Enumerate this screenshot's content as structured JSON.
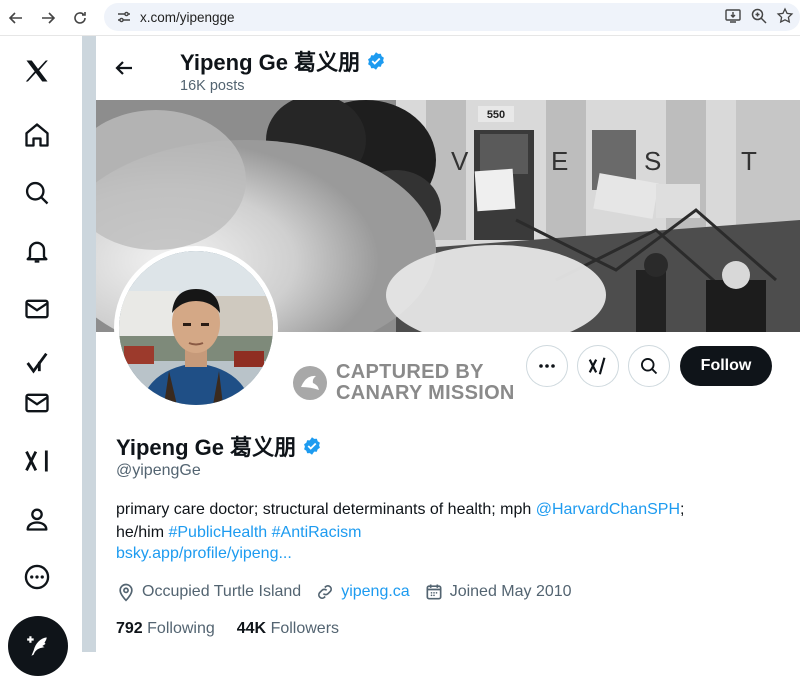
{
  "browser": {
    "url": "x.com/yipengge"
  },
  "header": {
    "name": "Yipeng Ge 葛义朋",
    "posts": "16K posts"
  },
  "banner": {
    "sign_number": "550",
    "graffiti": [
      "V",
      "E",
      "S",
      "T"
    ]
  },
  "watermark": {
    "line1": "CAPTURED BY",
    "line2": "CANARY MISSION"
  },
  "actions": {
    "follow_label": "Follow"
  },
  "profile": {
    "name": "Yipeng Ge 葛义朋",
    "handle": "@yipengGe",
    "bio_text_1": "primary care doctor; structural determinants of health; mph ",
    "bio_mention": "@HarvardChanSPH",
    "bio_text_2": ";",
    "bio_text_3": "he/him ",
    "bio_tag_1": "#PublicHealth",
    "bio_tag_2": "#AntiRacism",
    "bio_link": "bsky.app/profile/yipeng...",
    "location": "Occupied Turtle Island",
    "website": "yipeng.ca",
    "joined": "Joined May 2010",
    "following_count": "792",
    "following_label": "Following",
    "followers_count": "44K",
    "followers_label": "Followers"
  },
  "colors": {
    "accent": "#1d9bf0",
    "text": "#0f1419",
    "muted": "#536471"
  }
}
